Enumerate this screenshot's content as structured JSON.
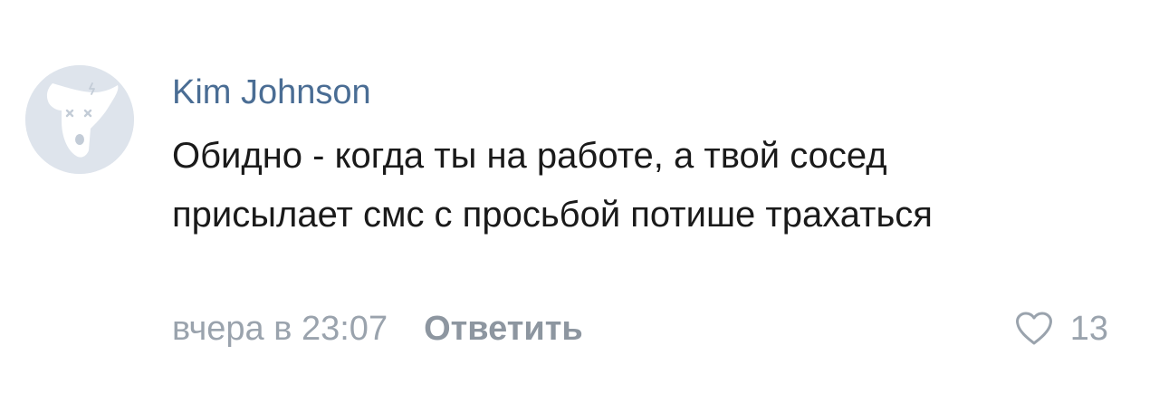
{
  "comment": {
    "author": "Kim Johnson",
    "text": "Обидно - когда ты на работе, а твой сосед присылает смс с просьбой потише трахаться",
    "timestamp": "вчера в 23:07",
    "reply_label": "Ответить",
    "likes_count": "13",
    "avatar_icon": "deactivated-dog-icon",
    "like_icon": "heart-outline-icon"
  },
  "colors": {
    "author": "#4a6d94",
    "text": "#1a1a1a",
    "meta": "#9aa3ad",
    "avatar_bg": "#dee4ec"
  }
}
